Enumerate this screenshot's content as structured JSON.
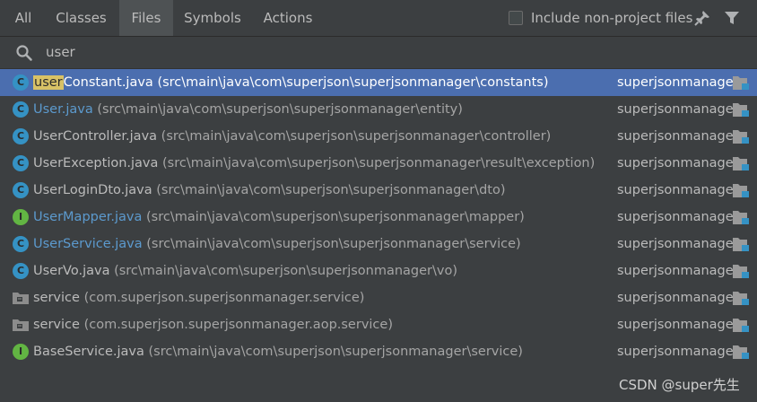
{
  "tabs": [
    {
      "label": "All",
      "active": false
    },
    {
      "label": "Classes",
      "active": false
    },
    {
      "label": "Files",
      "active": true
    },
    {
      "label": "Symbols",
      "active": false
    },
    {
      "label": "Actions",
      "active": false
    }
  ],
  "include_option": {
    "label": "Include non-project files",
    "checked": false
  },
  "toolbar": {
    "pin_icon": "pin-icon",
    "filter_icon": "filter-icon"
  },
  "search": {
    "value": "user",
    "icon": "search-icon"
  },
  "results": [
    {
      "icon": "class",
      "highlight": "user",
      "name": "Constant.java",
      "path": "(src\\main\\java\\com\\superjson\\superjsonmanager\\constants)",
      "module": "superjsonmanager",
      "selected": true,
      "blue": false
    },
    {
      "icon": "class",
      "highlight": "",
      "name": "User.java",
      "path": "(src\\main\\java\\com\\superjson\\superjsonmanager\\entity)",
      "module": "superjsonmanager",
      "selected": false,
      "blue": true
    },
    {
      "icon": "class",
      "highlight": "",
      "name": "UserController.java",
      "path": "(src\\main\\java\\com\\superjson\\superjsonmanager\\controller)",
      "module": "superjsonmanager",
      "selected": false,
      "blue": false
    },
    {
      "icon": "class",
      "highlight": "",
      "name": "UserException.java",
      "path": "(src\\main\\java\\com\\superjson\\superjsonmanager\\result\\exception)",
      "module": "superjsonmanager",
      "selected": false,
      "blue": false
    },
    {
      "icon": "class",
      "highlight": "",
      "name": "UserLoginDto.java",
      "path": "(src\\main\\java\\com\\superjson\\superjsonmanager\\dto)",
      "module": "superjsonmanager",
      "selected": false,
      "blue": false
    },
    {
      "icon": "interface",
      "highlight": "",
      "name": "UserMapper.java",
      "path": "(src\\main\\java\\com\\superjson\\superjsonmanager\\mapper)",
      "module": "superjsonmanager",
      "selected": false,
      "blue": true
    },
    {
      "icon": "class",
      "highlight": "",
      "name": "UserService.java",
      "path": "(src\\main\\java\\com\\superjson\\superjsonmanager\\service)",
      "module": "superjsonmanager",
      "selected": false,
      "blue": true
    },
    {
      "icon": "class",
      "highlight": "",
      "name": "UserVo.java",
      "path": "(src\\main\\java\\com\\superjson\\superjsonmanager\\vo)",
      "module": "superjsonmanager",
      "selected": false,
      "blue": false
    },
    {
      "icon": "folder",
      "highlight": "",
      "name": "service",
      "path": "(com.superjson.superjsonmanager.service)",
      "module": "superjsonmanager",
      "selected": false,
      "blue": false
    },
    {
      "icon": "folder",
      "highlight": "",
      "name": "service",
      "path": "(com.superjson.superjsonmanager.aop.service)",
      "module": "superjsonmanager",
      "selected": false,
      "blue": false
    },
    {
      "icon": "interface",
      "highlight": "",
      "name": "BaseService.java",
      "path": "(src\\main\\java\\com\\superjson\\superjsonmanager\\service)",
      "module": "superjsonmanager",
      "selected": false,
      "blue": false
    }
  ],
  "watermark": "CSDN @super先生",
  "colors": {
    "selection": "#4b6eaf",
    "class_icon": "#3592c4",
    "interface_icon": "#62b543",
    "highlight": "#d8c266",
    "link_name": "#5c9ace"
  }
}
